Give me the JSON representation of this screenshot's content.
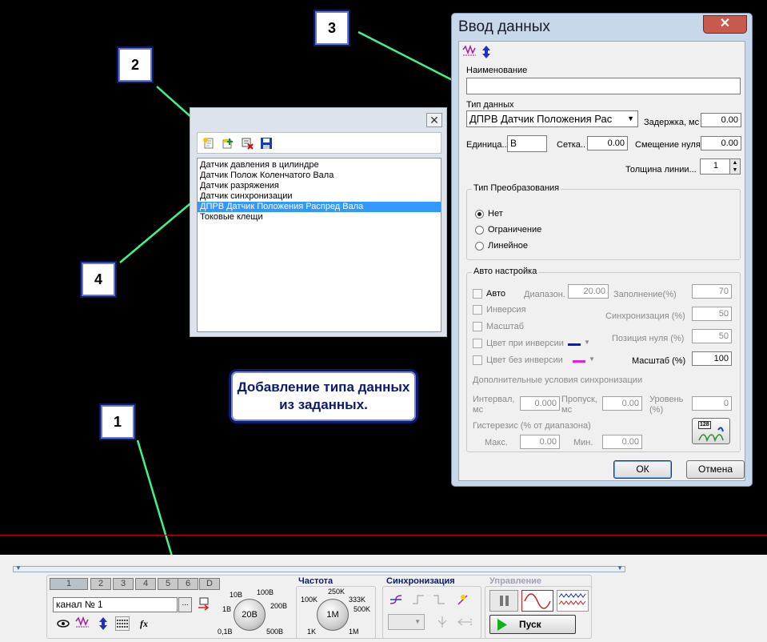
{
  "callouts": [
    "1",
    "2",
    "3",
    "4"
  ],
  "note": "Добавление типа данных из заданных.",
  "data_types_window": {
    "items": [
      "Датчик давления в цилиндре",
      "Датчик Полож Коленчатого Вала",
      "Датчик разряжения",
      "Датчик синхронизации",
      "ДПРВ Датчик Положения Распред Вала",
      "Токовые клещи"
    ],
    "selected_index": 4,
    "close_glyph": "✕"
  },
  "dialog": {
    "title": "Ввод данных",
    "close_glyph": "✕",
    "name_label": "Наименование",
    "name_value": "",
    "type_label": "Тип данных",
    "type_value": "ДПРВ Датчик Положения Рас",
    "delay_label": "Задержка, мс",
    "delay_value": "0.00",
    "unit_label": "Единица..",
    "unit_value": "В",
    "grid_label": "Сетка..",
    "grid_value": "0.00",
    "zero_offset_label": "Смещение нуля",
    "zero_offset_value": "0.00",
    "line_width_label": "Толщина линии...",
    "line_width_value": "1",
    "conversion": {
      "title": "Тип Преобразования",
      "options": [
        "Нет",
        "Ограничение",
        "Линейное"
      ],
      "selected": 0
    },
    "auto": {
      "title": "Авто настройка",
      "auto_label": "Авто",
      "range_label": "Диапазон.",
      "range_value": "20.00",
      "fill_label": "Заполнение(%)",
      "fill_value": "70",
      "inversion_label": "Инверсия",
      "sync_label": "Синхронизация (%)",
      "sync_value": "50",
      "scale_check_label": "Масштаб",
      "zero_pos_label": "Позиция нуля (%)",
      "zero_pos_value": "50",
      "color_inv_label": "Цвет при инверсии",
      "color_inv": "#1010e0",
      "scale_label": "Масштаб (%)",
      "scale_value": "100",
      "color_noinv_label": "Цвет без инверсии",
      "color_noinv": "#e020e0",
      "extra_sync_label": "Дополнительные условия синхронизации",
      "interval_label": "Интервал,",
      "interval_unit": "мс",
      "interval_value": "0.000",
      "skip_label": "Пропуск,",
      "skip_unit": "мс",
      "skip_value": "0.00",
      "level_label": "Уровень",
      "level_unit": "(%)",
      "level_value": "0",
      "hysteresis_label": "Гистерезис (% от диапазона)",
      "max_label": "Макс.",
      "max_value": "0.00",
      "min_label": "Мин.",
      "min_value": "0.00",
      "auto_icon_text": "128"
    },
    "ok_label": "ОК",
    "cancel_label": "Отмена"
  },
  "bottom": {
    "channel_tabs": [
      "1",
      "2",
      "3",
      "4",
      "5",
      "6",
      "D"
    ],
    "channel_name": "канал № 1",
    "channel_btn": "...",
    "amplitude_ticks": [
      "10В",
      "100В",
      "1В",
      "200В",
      "0,1В",
      "500В"
    ],
    "amplitude_value": "20В",
    "freq_title": "Частота",
    "freq_ticks": [
      "250K",
      "100K",
      "333K",
      "500K",
      "1K",
      "1M"
    ],
    "freq_value": "1M",
    "sync_title": "Синхронизация",
    "control_title": "Управление",
    "start_label": "Пуск",
    "fx_label": "fx"
  }
}
